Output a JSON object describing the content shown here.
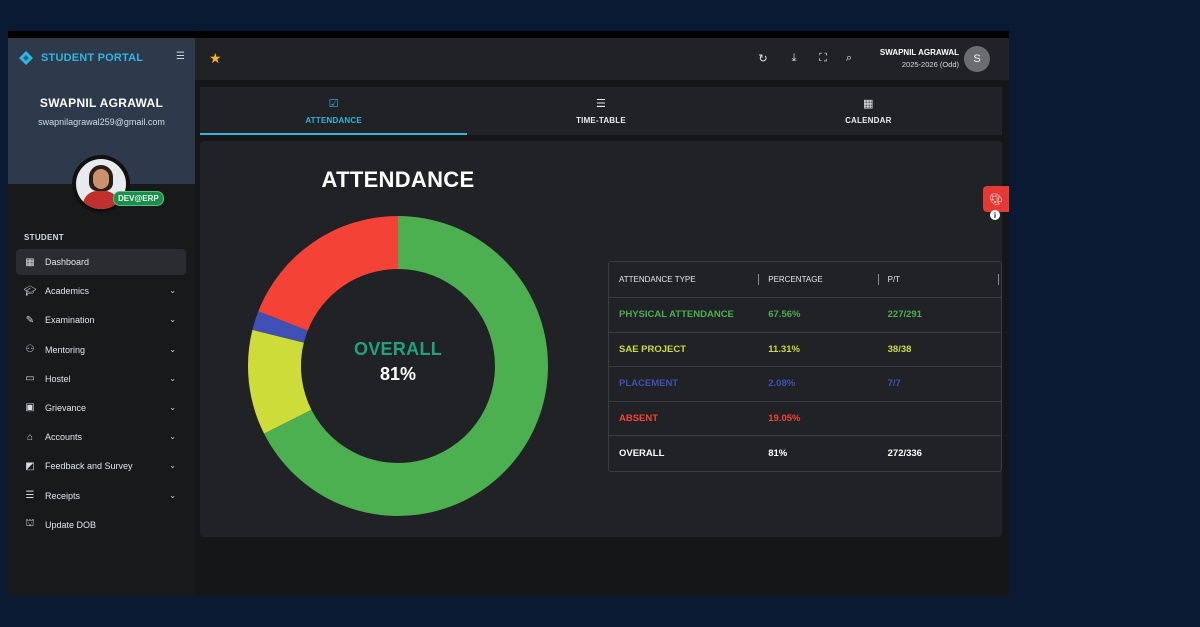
{
  "sidebar": {
    "brand": "STUDENT PORTAL",
    "user_name": "SWAPNIL AGRAWAL",
    "user_email": "swapnilagrawal259@gmail.com",
    "badge": "DEV@ERP",
    "section": "STUDENT",
    "items": [
      {
        "label": "Dashboard",
        "icon": "dashboard-icon",
        "chevron": false,
        "active": true
      },
      {
        "label": "Academics",
        "icon": "graduation-cap-icon",
        "chevron": true
      },
      {
        "label": "Examination",
        "icon": "pencil-icon",
        "chevron": true
      },
      {
        "label": "Mentoring",
        "icon": "people-icon",
        "chevron": true
      },
      {
        "label": "Hostel",
        "icon": "bed-icon",
        "chevron": true
      },
      {
        "label": "Grievance",
        "icon": "ticket-icon",
        "chevron": true
      },
      {
        "label": "Accounts",
        "icon": "bank-icon",
        "chevron": true
      },
      {
        "label": "Feedback and Survey",
        "icon": "feedback-icon",
        "chevron": true
      },
      {
        "label": "Receipts",
        "icon": "receipt-icon",
        "chevron": true
      },
      {
        "label": "Update DOB",
        "icon": "cake-icon",
        "chevron": false
      }
    ]
  },
  "topbar": {
    "user_name": "SWAPNIL AGRAWAL",
    "session": "2025-2026 (Odd)",
    "avatar_letter": "S"
  },
  "tabs": [
    {
      "label": "ATTENDANCE",
      "icon": "calendar-check-icon",
      "active": true
    },
    {
      "label": "TIME-TABLE",
      "icon": "list-icon",
      "active": false
    },
    {
      "label": "CALENDAR",
      "icon": "calendar-icon",
      "active": false
    }
  ],
  "main": {
    "title": "ATTENDANCE",
    "donut_label": "OVERALL",
    "donut_value": "81%",
    "table": {
      "headers": [
        "ATTENDANCE TYPE",
        "PERCENTAGE",
        "P/T"
      ],
      "rows": [
        {
          "type": "PHYSICAL ATTENDANCE",
          "percentage": "67.56%",
          "pt": "227/291",
          "color": "#4caf50"
        },
        {
          "type": "SAE PROJECT",
          "percentage": "11.31%",
          "pt": "38/38",
          "color": "#cddc39"
        },
        {
          "type": "PLACEMENT",
          "percentage": "2.08%",
          "pt": "7/7",
          "color": "#3f51b5"
        },
        {
          "type": "ABSENT",
          "percentage": "19.05%",
          "pt": "",
          "color": "#f44336"
        },
        {
          "type": "OVERALL",
          "percentage": "81%",
          "pt": "272/336",
          "color": "#ffffff"
        }
      ]
    }
  },
  "chart_data": {
    "type": "pie",
    "categories": [
      "PHYSICAL ATTENDANCE",
      "SAE PROJECT",
      "PLACEMENT",
      "ABSENT"
    ],
    "values": [
      67.56,
      11.31,
      2.08,
      19.05
    ],
    "colors": [
      "#4caf50",
      "#cddc39",
      "#3f51b5",
      "#f44336"
    ],
    "title": "ATTENDANCE"
  }
}
